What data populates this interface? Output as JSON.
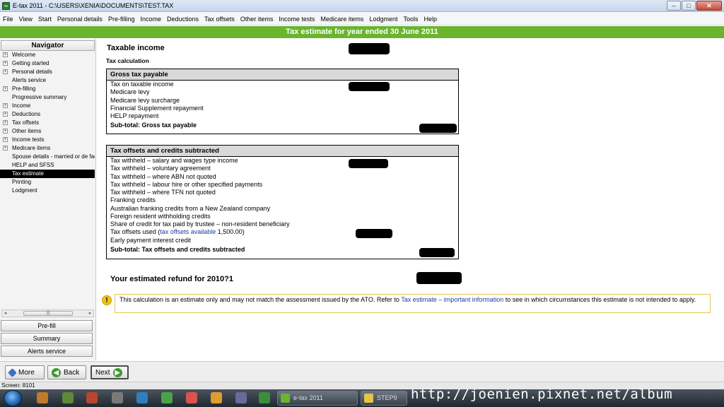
{
  "window": {
    "title": "E-tax 2011 - C:\\USERS\\XENIA\\DOCUMENTS\\TEST.TAX",
    "controls": {
      "minimize": "–",
      "maximize": "□",
      "close": "✕"
    }
  },
  "menu": [
    "File",
    "View",
    "Start",
    "Personal details",
    "Pre-filling",
    "Income",
    "Deductions",
    "Tax offsets",
    "Other items",
    "Income tests",
    "Medicare items",
    "Lodgment",
    "Tools",
    "Help"
  ],
  "header": {
    "title": "Tax estimate for year ended 30 June 2011",
    "color": "#6ab42e"
  },
  "navigator": {
    "title": "Navigator",
    "items": [
      {
        "label": "Welcome",
        "expandable": true
      },
      {
        "label": "Getting started",
        "expandable": true
      },
      {
        "label": "Personal details",
        "expandable": true
      },
      {
        "label": "Alerts service",
        "expandable": false
      },
      {
        "label": "Pre-filling",
        "expandable": true
      },
      {
        "label": "Progressive summary",
        "expandable": false
      },
      {
        "label": "Income",
        "expandable": true
      },
      {
        "label": "Deductions",
        "expandable": true
      },
      {
        "label": "Tax offsets",
        "expandable": true
      },
      {
        "label": "Other items",
        "expandable": true
      },
      {
        "label": "Income tests",
        "expandable": true
      },
      {
        "label": "Medicare items",
        "expandable": true
      },
      {
        "label": "Spouse details - married or de facto",
        "expandable": false
      },
      {
        "label": "HELP and SFSS",
        "expandable": false
      },
      {
        "label": "Tax estimate",
        "expandable": false,
        "selected": true
      },
      {
        "label": "Printing",
        "expandable": false
      },
      {
        "label": "Lodgment",
        "expandable": false
      }
    ],
    "buttons": {
      "prefill": "Pre-fill",
      "summary": "Summary",
      "alerts": "Alerts service"
    },
    "scroll_left": "◂",
    "scroll_right": "▸",
    "scroll_grip": "|||"
  },
  "main": {
    "taxable_income_label": "Taxable income",
    "tax_calculation_label": "Tax calculation",
    "gross_box": {
      "header": "Gross tax payable",
      "rows": [
        "Tax on taxable income",
        "Medicare levy",
        "Medicare levy surcharge",
        "Financial Supplement repayment",
        "HELP repayment"
      ],
      "subtotal": "Sub-total: Gross tax payable"
    },
    "offsets_box": {
      "header": "Tax offsets and credits subtracted",
      "rows": [
        "Tax withheld – salary and wages type income",
        "Tax withheld – voluntary agreement",
        "Tax withheld – where ABN not quoted",
        "Tax withheld – labour hire or other specified payments",
        "Tax withheld – where TFN not quoted",
        "Franking credits",
        "Australian franking credits from a New Zealand company",
        "Foreign resident withholding credits",
        "Share of credit for tax paid by trustee – non-resident beneficiary"
      ],
      "offsets_used_prefix": "Tax offsets used (",
      "offsets_used_link": "tax offsets available",
      "offsets_used_suffix": " 1,500.00)",
      "last_row": "Early payment interest credit",
      "subtotal": "Sub-total: Tax offsets and credits subtracted"
    },
    "refund_label": "Your estimated refund for 2010?1",
    "notice": {
      "icon": "!",
      "text_before": "This calculation is an estimate only and may not match the assessment issued by the ATO. Refer to ",
      "link": "Tax estimate – important information",
      "text_after": " to see in which circumstances this estimate is not intended to apply."
    }
  },
  "bottom": {
    "more": "More",
    "back": "Back",
    "next": "Next",
    "back_icon": "◀",
    "next_icon": "▶"
  },
  "status": {
    "text": "Screen: 8101"
  },
  "taskbar": {
    "tasks": [
      {
        "label": "e-tax 2011"
      },
      {
        "label": "STEP9"
      }
    ],
    "watermark": "http://joenien.pixnet.net/album"
  }
}
